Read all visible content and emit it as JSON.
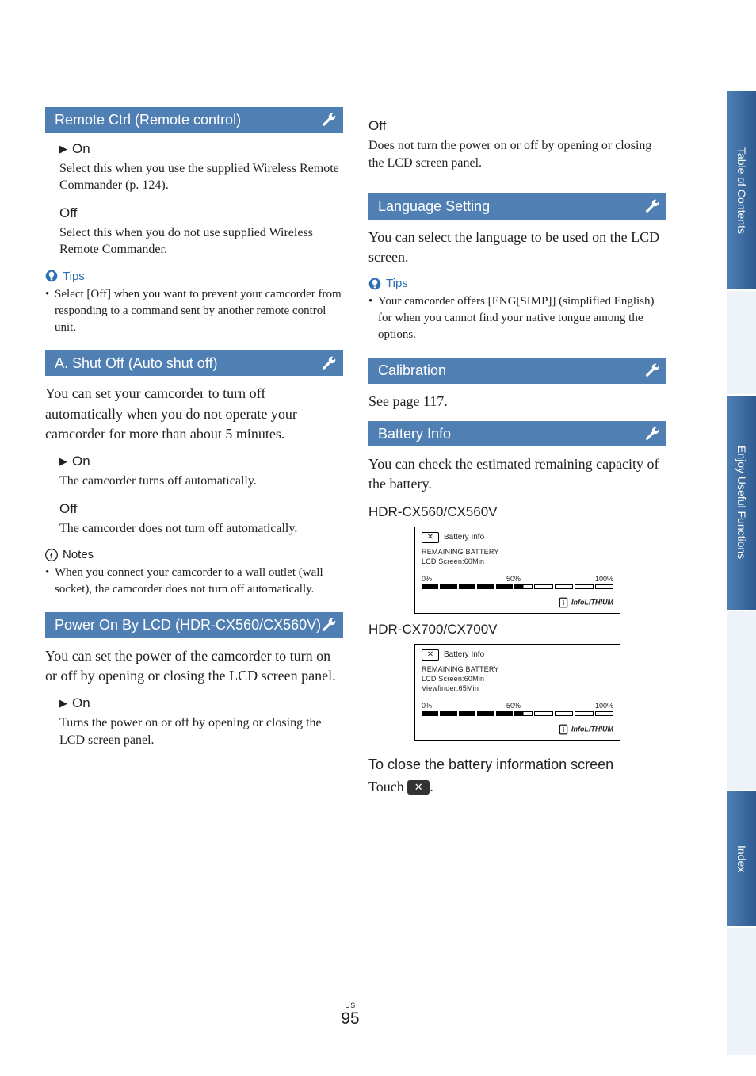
{
  "side_tabs": {
    "toc": "Table of Contents",
    "enjoy": "Enjoy Useful Functions",
    "index": "Index"
  },
  "page_number": {
    "region": "US",
    "num": "95"
  },
  "col1": {
    "remote": {
      "heading": "Remote Ctrl (Remote control)",
      "on": {
        "label": "On",
        "desc": "Select this when you use the supplied Wireless Remote Commander (p. 124)."
      },
      "off": {
        "label": "Off",
        "desc": "Select this when you do not use supplied Wireless Remote Commander."
      },
      "tips_label": "Tips",
      "tips_item": "Select [Off] when you want to prevent your camcorder from responding to a command sent by another remote control unit."
    },
    "autoshut": {
      "heading": "A. Shut Off (Auto shut off)",
      "intro": "You can set your camcorder to turn off automatically when you do not operate your camcorder for more than about 5 minutes.",
      "on": {
        "label": "On",
        "desc": "The camcorder turns off automatically."
      },
      "off": {
        "label": "Off",
        "desc": "The camcorder does not turn off automatically."
      },
      "notes_label": "Notes",
      "notes_item": "When you connect your camcorder to a wall outlet (wall socket), the camcorder does not turn off automatically."
    },
    "powerlcd": {
      "heading": "Power On By LCD (HDR-CX560/CX560V)",
      "intro": "You can set the power of the camcorder to turn on or off by opening or closing the LCD screen panel.",
      "on": {
        "label": "On",
        "desc": "Turns the power on or off by opening or closing the LCD screen panel."
      }
    }
  },
  "col2": {
    "powerlcd_off": {
      "label": "Off",
      "desc": "Does not turn the power on or off by opening or closing the LCD screen panel."
    },
    "lang": {
      "heading": "Language Setting",
      "intro": "You can select the language to be used on the LCD screen.",
      "tips_label": "Tips",
      "tips_item": "Your camcorder offers [ENG[SIMP]] (simplified English) for when you cannot find your native tongue among the options."
    },
    "calib": {
      "heading": "Calibration",
      "intro": "See page 117."
    },
    "battery": {
      "heading": "Battery Info",
      "intro": "You can check the estimated remaining capacity of the battery.",
      "model1": "HDR-CX560/CX560V",
      "model2": "HDR-CX700/CX700V",
      "panel1": {
        "title": "Battery Info",
        "line1": "REMAINING BATTERY",
        "line2": "LCD Screen:60Min",
        "s0": "0%",
        "s50": "50%",
        "s100": "100%",
        "logo": "InfoLITHIUM"
      },
      "panel2": {
        "title": "Battery Info",
        "line1": "REMAINING BATTERY",
        "line2": "LCD Screen:60Min",
        "line3": "Viewfinder:65Min",
        "s0": "0%",
        "s50": "50%",
        "s100": "100%",
        "logo": "InfoLITHIUM"
      },
      "close_h": "To close the battery information screen",
      "touch_prefix": "Touch ",
      "touch_suffix": "."
    }
  },
  "chart_data": [
    {
      "type": "bar",
      "title": "Battery Info — HDR-CX560/CX560V",
      "remaining_battery_lcd_min": 60,
      "xlabel": "Remaining battery",
      "tick_labels": [
        "0%",
        "50%",
        "100%"
      ],
      "xlim": [
        0,
        100
      ],
      "values": [
        55
      ]
    },
    {
      "type": "bar",
      "title": "Battery Info — HDR-CX700/CX700V",
      "remaining_battery_lcd_min": 60,
      "remaining_battery_viewfinder_min": 65,
      "xlabel": "Remaining battery",
      "tick_labels": [
        "0%",
        "50%",
        "100%"
      ],
      "xlim": [
        0,
        100
      ],
      "values": [
        55
      ]
    }
  ]
}
